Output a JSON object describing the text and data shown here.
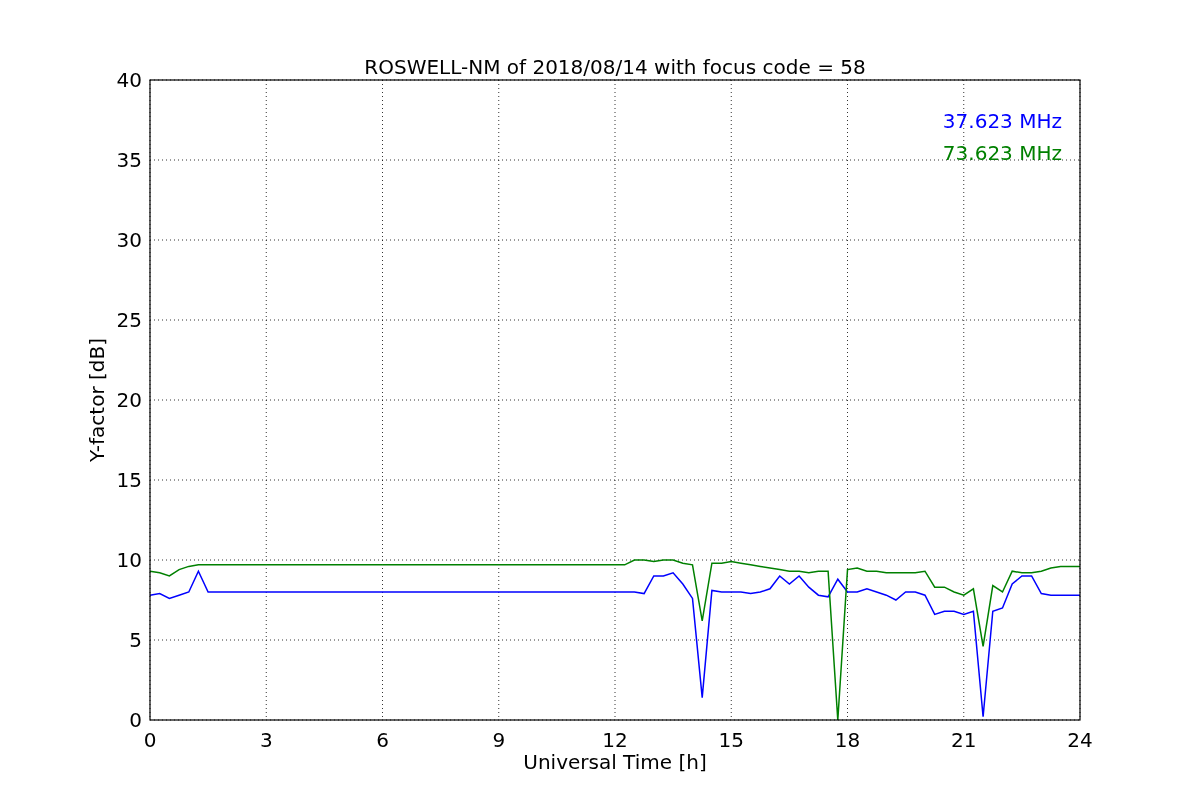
{
  "chart_data": {
    "type": "line",
    "title": "ROSWELL-NM of 2018/08/14 with focus code = 58",
    "xlabel": "Universal Time [h]",
    "ylabel": "Y-factor [dB]",
    "x": [
      0,
      0.25,
      0.5,
      0.75,
      1,
      1.25,
      1.5,
      1.75,
      2,
      2.25,
      2.5,
      2.75,
      3,
      3.25,
      3.5,
      3.75,
      4,
      4.25,
      4.5,
      4.75,
      5,
      5.25,
      5.5,
      5.75,
      6,
      6.25,
      6.5,
      6.75,
      7,
      7.25,
      7.5,
      7.75,
      8,
      8.25,
      8.5,
      8.75,
      9,
      9.25,
      9.5,
      9.75,
      10,
      10.25,
      10.5,
      10.75,
      11,
      11.25,
      11.5,
      11.75,
      12,
      12.25,
      12.5,
      12.75,
      13,
      13.25,
      13.5,
      13.75,
      14,
      14.25,
      14.5,
      14.75,
      15,
      15.25,
      15.5,
      15.75,
      16,
      16.25,
      16.5,
      16.75,
      17,
      17.25,
      17.5,
      17.75,
      18,
      18.25,
      18.5,
      18.75,
      19,
      19.25,
      19.5,
      19.75,
      20,
      20.25,
      20.5,
      20.75,
      21,
      21.25,
      21.5,
      21.75,
      22,
      22.25,
      22.5,
      22.75,
      23,
      23.25,
      23.5,
      23.75,
      24
    ],
    "series": [
      {
        "name": "37.623 MHz",
        "color": "#0000ff",
        "values": [
          7.8,
          7.9,
          7.6,
          7.8,
          8.0,
          9.3,
          8.0,
          8.0,
          8.0,
          8.0,
          8.0,
          8.0,
          8.0,
          8.0,
          8.0,
          8.0,
          8.0,
          8.0,
          8.0,
          8.0,
          8.0,
          8.0,
          8.0,
          8.0,
          8.0,
          8.0,
          8.0,
          8.0,
          8.0,
          8.0,
          8.0,
          8.0,
          8.0,
          8.0,
          8.0,
          8.0,
          8.0,
          8.0,
          8.0,
          8.0,
          8.0,
          8.0,
          8.0,
          8.0,
          8.0,
          8.0,
          8.0,
          8.0,
          8.0,
          8.0,
          8.0,
          7.9,
          9.0,
          9.0,
          9.2,
          8.5,
          7.6,
          1.4,
          8.1,
          8.0,
          8.0,
          8.0,
          7.9,
          8.0,
          8.2,
          9.0,
          8.5,
          9.0,
          8.3,
          7.8,
          7.7,
          8.8,
          8.0,
          8.0,
          8.2,
          8.0,
          7.8,
          7.5,
          8.0,
          8.0,
          7.8,
          6.6,
          6.8,
          6.8,
          6.6,
          6.8,
          0.2,
          6.8,
          7.0,
          8.5,
          9.0,
          9.0,
          7.9,
          7.8,
          7.8,
          7.8,
          7.8
        ]
      },
      {
        "name": "73.623 MHz",
        "color": "#008000",
        "values": [
          9.3,
          9.2,
          9.0,
          9.4,
          9.6,
          9.7,
          9.7,
          9.7,
          9.7,
          9.7,
          9.7,
          9.7,
          9.7,
          9.7,
          9.7,
          9.7,
          9.7,
          9.7,
          9.7,
          9.7,
          9.7,
          9.7,
          9.7,
          9.7,
          9.7,
          9.7,
          9.7,
          9.7,
          9.7,
          9.7,
          9.7,
          9.7,
          9.7,
          9.7,
          9.7,
          9.7,
          9.7,
          9.7,
          9.7,
          9.7,
          9.7,
          9.7,
          9.7,
          9.7,
          9.7,
          9.7,
          9.7,
          9.7,
          9.7,
          9.7,
          10.0,
          10.0,
          9.9,
          10.0,
          10.0,
          9.8,
          9.7,
          6.2,
          9.8,
          9.8,
          9.9,
          9.8,
          9.7,
          9.6,
          9.5,
          9.4,
          9.3,
          9.3,
          9.2,
          9.3,
          9.3,
          0.0,
          9.4,
          9.5,
          9.3,
          9.3,
          9.2,
          9.2,
          9.2,
          9.2,
          9.3,
          8.3,
          8.3,
          8.0,
          7.8,
          8.2,
          4.6,
          8.4,
          8.0,
          9.3,
          9.2,
          9.2,
          9.3,
          9.5,
          9.6,
          9.6,
          9.6
        ]
      }
    ],
    "xlim": [
      0,
      24
    ],
    "ylim": [
      0,
      40
    ],
    "xticks": [
      0,
      3,
      6,
      9,
      12,
      15,
      18,
      21,
      24
    ],
    "yticks": [
      0,
      5,
      10,
      15,
      20,
      25,
      30,
      35,
      40
    ],
    "grid": true
  }
}
